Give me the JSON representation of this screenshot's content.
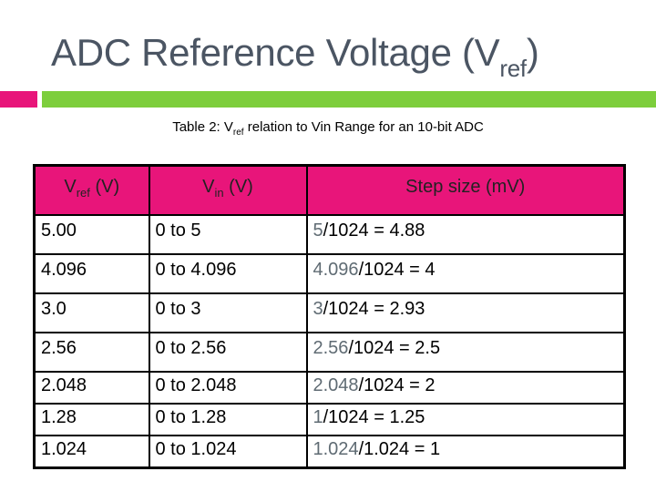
{
  "slide": {
    "title_main": "ADC Reference Voltage (V",
    "title_sub": "ref",
    "title_end": ")"
  },
  "accents": {
    "pink": "#e8157a",
    "green": "#7dce3c"
  },
  "caption": {
    "prefix": "Table 2: V",
    "sub": "ref",
    "suffix": " relation to Vin Range for an 10-bit ADC"
  },
  "table": {
    "headers": [
      {
        "main": "V",
        "sub": "ref",
        "suffix": " (V)"
      },
      {
        "main": "V",
        "sub": "in",
        "suffix": " (V)"
      },
      {
        "main": "Step size (mV)",
        "sub": "",
        "suffix": ""
      }
    ],
    "rows": [
      {
        "vref": "5.00",
        "vin": "0 to 5",
        "step_num": "5",
        "step_rest": "/1024 = 4.88"
      },
      {
        "vref": "4.096",
        "vin": "0 to 4.096",
        "step_num": "4.096",
        "step_rest": "/1024 = 4"
      },
      {
        "vref": "3.0",
        "vin": "0 to 3",
        "step_num": "3",
        "step_rest": "/1024 = 2.93"
      },
      {
        "vref": "2.56",
        "vin": "0 to 2.56",
        "step_num": "2.56",
        "step_rest": "/1024 = 2.5"
      },
      {
        "vref": "2.048",
        "vin": "0 to 2.048",
        "step_num": "2.048",
        "step_rest": "/1024 = 2"
      },
      {
        "vref": "1.28",
        "vin": "0 to 1.28",
        "step_num": "1",
        "step_rest": "/1024 = 1.25"
      },
      {
        "vref": "1.024",
        "vin": "0 to 1.024",
        "step_num": "1.024",
        "step_rest": "/1.024 = 1"
      }
    ]
  }
}
